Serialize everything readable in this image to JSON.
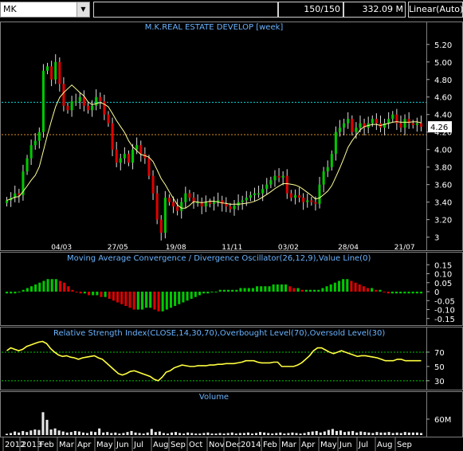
{
  "toolbar": {
    "symbol": "MK",
    "blank": "",
    "bar_count": "150/150",
    "last_price": "332.09 M",
    "scale_mode": "Linear(Auto)"
  },
  "colors": {
    "up": "#00c800",
    "down": "#e00000",
    "ma_line": "#ffff99",
    "rsi_line": "#ffff40",
    "volume": "#e8e8e8",
    "title": "#6ab4ff",
    "grid": "#404040",
    "ref_cyan": "#00d8d8",
    "ref_orange": "#d89020",
    "price_label_bg": "#ffffff"
  },
  "chart_data": [
    {
      "type": "candlestick",
      "title": "M.K.REAL ESTATE DEVELOP [week]",
      "yticks": [
        "5.20",
        "5.00",
        "4.80",
        "4.60",
        "4.40",
        "4.20",
        "4.00",
        "3.80",
        "3.60",
        "3.40",
        "3.20",
        "3"
      ],
      "ylim": [
        2.96,
        5.28
      ],
      "last_price_label": "4.26",
      "reference_lines": [
        {
          "value": 4.54,
          "color": "cyan"
        },
        {
          "value": 4.17,
          "color": "orange"
        }
      ],
      "overlay_line": "moving average",
      "close_values": [
        3.42,
        3.45,
        3.5,
        3.48,
        3.75,
        3.9,
        4.05,
        4.1,
        4.2,
        4.9,
        4.95,
        4.8,
        5.0,
        4.75,
        4.5,
        4.45,
        4.55,
        4.55,
        4.6,
        4.5,
        4.45,
        4.5,
        4.6,
        4.55,
        4.4,
        4.3,
        4.0,
        3.85,
        3.9,
        3.95,
        3.85,
        4.0,
        4.05,
        3.95,
        3.9,
        3.7,
        3.5,
        3.2,
        3.05,
        3.45,
        3.4,
        3.35,
        3.3,
        3.4,
        3.5,
        3.45,
        3.4,
        3.4,
        3.35,
        3.4,
        3.38,
        3.4,
        3.42,
        3.38,
        3.35,
        3.32,
        3.36,
        3.4,
        3.42,
        3.45,
        3.48,
        3.5,
        3.5,
        3.55,
        3.6,
        3.65,
        3.7,
        3.68,
        3.7,
        3.5,
        3.45,
        3.48,
        3.45,
        3.4,
        3.42,
        3.4,
        3.38,
        3.6,
        3.75,
        3.8,
        3.95,
        4.2,
        4.25,
        4.3,
        4.35,
        4.2,
        4.25,
        4.3,
        4.25,
        4.3,
        4.35,
        4.3,
        4.25,
        4.3,
        4.35,
        4.4,
        4.3,
        4.25,
        4.35,
        4.3,
        4.28,
        4.3,
        4.26
      ],
      "x_date_labels_inline": [
        "04/03",
        "27/05",
        "19/08",
        "11/11",
        "03/02",
        "28/04",
        "21/07"
      ]
    },
    {
      "type": "bar",
      "title": "Moving Average Convergence / Divergence Oscillator(26,12,9),Value Line(0)",
      "yticks": [
        "0.15",
        "0.10",
        "0.05",
        "0",
        "-0.05",
        "-0.10",
        "-0.15"
      ],
      "ylim": [
        -0.16,
        0.16
      ],
      "values": [
        -0.01,
        -0.01,
        -0.01,
        0.0,
        0.01,
        0.02,
        0.03,
        0.04,
        0.05,
        0.06,
        0.07,
        0.07,
        0.07,
        0.06,
        0.05,
        0.03,
        0.01,
        0.0,
        -0.01,
        -0.01,
        -0.02,
        -0.02,
        -0.02,
        -0.03,
        -0.03,
        -0.04,
        -0.05,
        -0.06,
        -0.07,
        -0.08,
        -0.09,
        -0.1,
        -0.1,
        -0.1,
        -0.09,
        -0.09,
        -0.1,
        -0.11,
        -0.11,
        -0.1,
        -0.09,
        -0.08,
        -0.07,
        -0.06,
        -0.05,
        -0.04,
        -0.03,
        -0.02,
        -0.01,
        -0.01,
        0.0,
        0.0,
        0.01,
        0.01,
        0.01,
        0.01,
        0.01,
        0.02,
        0.02,
        0.02,
        0.02,
        0.03,
        0.03,
        0.03,
        0.03,
        0.04,
        0.04,
        0.04,
        0.04,
        0.03,
        0.02,
        0.02,
        0.01,
        0.01,
        0.01,
        0.01,
        0.01,
        0.02,
        0.03,
        0.04,
        0.05,
        0.06,
        0.07,
        0.07,
        0.06,
        0.05,
        0.04,
        0.03,
        0.02,
        0.02,
        0.01,
        0.01,
        0.0,
        -0.01,
        -0.01,
        -0.01,
        -0.01,
        -0.01,
        -0.01,
        -0.01,
        -0.01,
        -0.01
      ]
    },
    {
      "type": "line",
      "title": "Relative Strength Index(CLOSE,14,30,70),Overbought Level(70),Oversold Level(30)",
      "yticks": [
        "70",
        "50",
        "30"
      ],
      "ylim": [
        22,
        90
      ],
      "overbought": 70,
      "oversold": 30,
      "values": [
        72,
        76,
        74,
        72,
        74,
        78,
        80,
        82,
        84,
        85,
        82,
        75,
        70,
        66,
        64,
        65,
        63,
        62,
        60,
        62,
        63,
        64,
        65,
        62,
        60,
        55,
        50,
        45,
        40,
        38,
        40,
        43,
        44,
        42,
        40,
        38,
        36,
        32,
        30,
        35,
        42,
        44,
        48,
        50,
        52,
        51,
        50,
        50,
        51,
        51,
        51,
        52,
        52,
        53,
        53,
        54,
        54,
        54,
        55,
        56,
        58,
        58,
        58,
        56,
        55,
        55,
        55,
        56,
        56,
        50,
        50,
        50,
        50,
        52,
        55,
        60,
        65,
        72,
        76,
        76,
        73,
        70,
        68,
        70,
        72,
        70,
        68,
        66,
        64,
        65,
        65,
        64,
        63,
        62,
        60,
        58,
        58,
        58,
        60,
        60,
        58,
        58,
        58,
        58,
        58
      ]
    },
    {
      "type": "bar",
      "title": "Volume",
      "yticks": [
        "60M"
      ],
      "ylim": [
        0,
        160
      ],
      "values": [
        5,
        8,
        14,
        10,
        16,
        12,
        18,
        22,
        20,
        90,
        60,
        22,
        26,
        18,
        14,
        10,
        12,
        16,
        14,
        10,
        8,
        14,
        12,
        26,
        10,
        12,
        8,
        10,
        6,
        8,
        12,
        16,
        10,
        8,
        6,
        10,
        24,
        12,
        14,
        8,
        6,
        10,
        12,
        8,
        6,
        10,
        8,
        6,
        6,
        8,
        10,
        6,
        6,
        8,
        6,
        8,
        10,
        6,
        8,
        8,
        10,
        6,
        8,
        12,
        10,
        8,
        6,
        8,
        10,
        6,
        8,
        10,
        8,
        6,
        8,
        12,
        14,
        16,
        10,
        14,
        20,
        24,
        16,
        18,
        12,
        14,
        16,
        10,
        14,
        12,
        10,
        8,
        12,
        10,
        10,
        12,
        8,
        10,
        8,
        12,
        10,
        10,
        10,
        8
      ]
    }
  ],
  "x_axis": {
    "labels": [
      "2012",
      "2013",
      "Feb",
      "Mar",
      "Apr",
      "May",
      "Jun",
      "Jul",
      "Aug",
      "Sep",
      "Oct",
      "Nov",
      "Dec",
      "2014",
      "Feb",
      "Mar",
      "Apr",
      "May",
      "Jun",
      "Jul",
      "Aug",
      "Sep"
    ]
  }
}
